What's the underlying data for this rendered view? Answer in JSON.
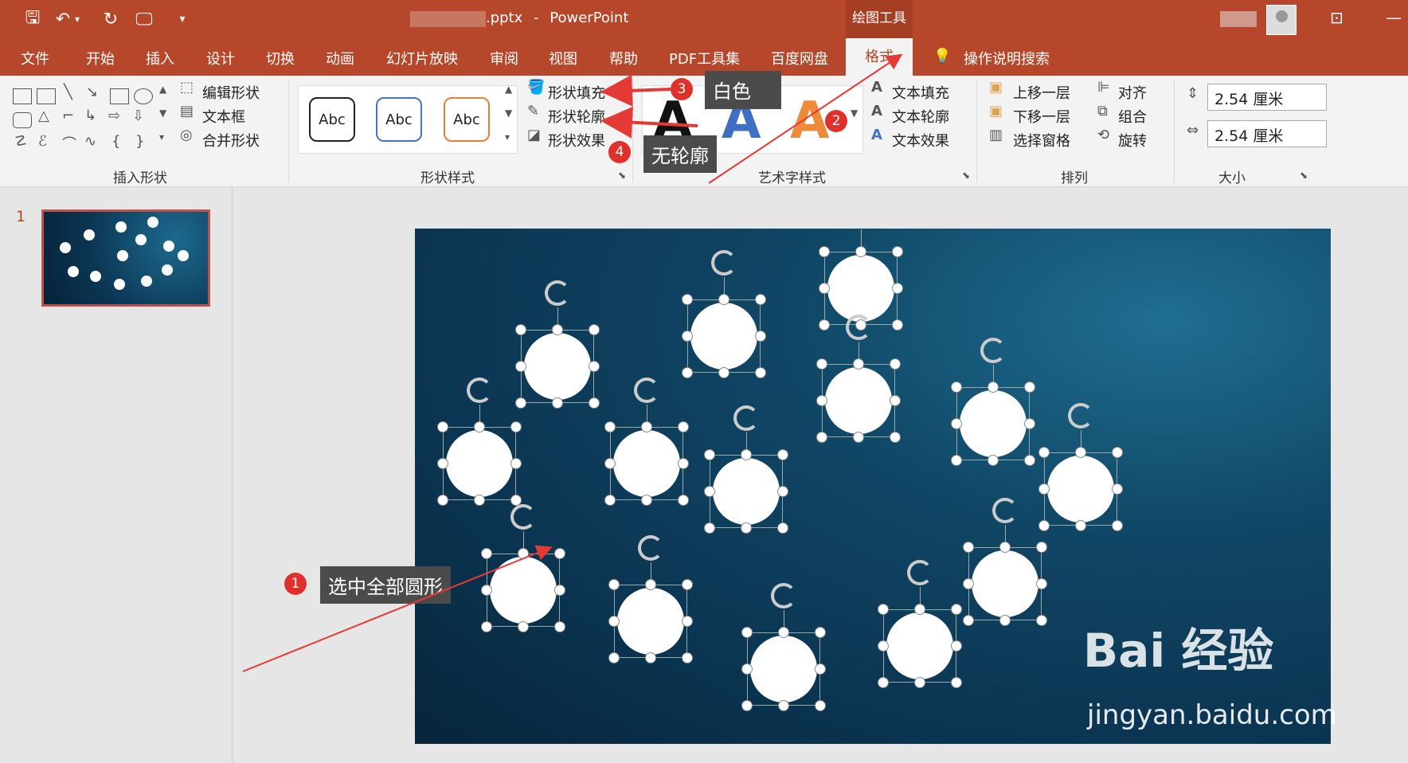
{
  "titlebar": {
    "file_name": ".pptx",
    "app_sep": "-",
    "app_name": "PowerPoint",
    "context_group": "绘图工具",
    "customize_glyph": "▾"
  },
  "tabs": [
    "文件",
    "开始",
    "插入",
    "设计",
    "切换",
    "动画",
    "幻灯片放映",
    "审阅",
    "视图",
    "帮助",
    "PDF工具集",
    "百度网盘"
  ],
  "active_tab": "格式",
  "tell_me": "操作说明搜索",
  "ribbon": {
    "insert_shapes": {
      "label": "插入形状",
      "edit_shape": "编辑形状",
      "text_box": "文本框",
      "merge_shapes": "合并形状"
    },
    "shape_styles": {
      "label": "形状样式",
      "preset1": "Abc",
      "preset2": "Abc",
      "preset3": "Abc",
      "fill": "形状填充",
      "outline": "形状轮廓",
      "effects": "形状效果"
    },
    "wordart": {
      "label": "艺术字样式",
      "letter": "A",
      "text_fill": "文本填充",
      "text_outline": "文本轮廓",
      "text_effects": "文本效果"
    },
    "arrange": {
      "label": "排列",
      "bring_forward": "上移一层",
      "send_backward": "下移一层",
      "selection_pane": "选择窗格",
      "align": "对齐",
      "group": "组合",
      "rotate": "旋转"
    },
    "size": {
      "label": "大小",
      "height": "2.54 厘米",
      "width": "2.54 厘米"
    }
  },
  "slides_pane": {
    "slide_number": "1"
  },
  "annotations": [
    {
      "num": "1",
      "text": "选中全部圆形"
    },
    {
      "num": "2",
      "text": ""
    },
    {
      "num": "3",
      "text": "白色"
    },
    {
      "num": "4",
      "text": "无轮廓"
    }
  ],
  "watermark": {
    "logo": "Bai 经验",
    "url": "jingyan.baidu.com"
  },
  "colors": {
    "accent": "#b7472a",
    "arrow": "#e53935",
    "slide_bg": "#0b3552"
  }
}
